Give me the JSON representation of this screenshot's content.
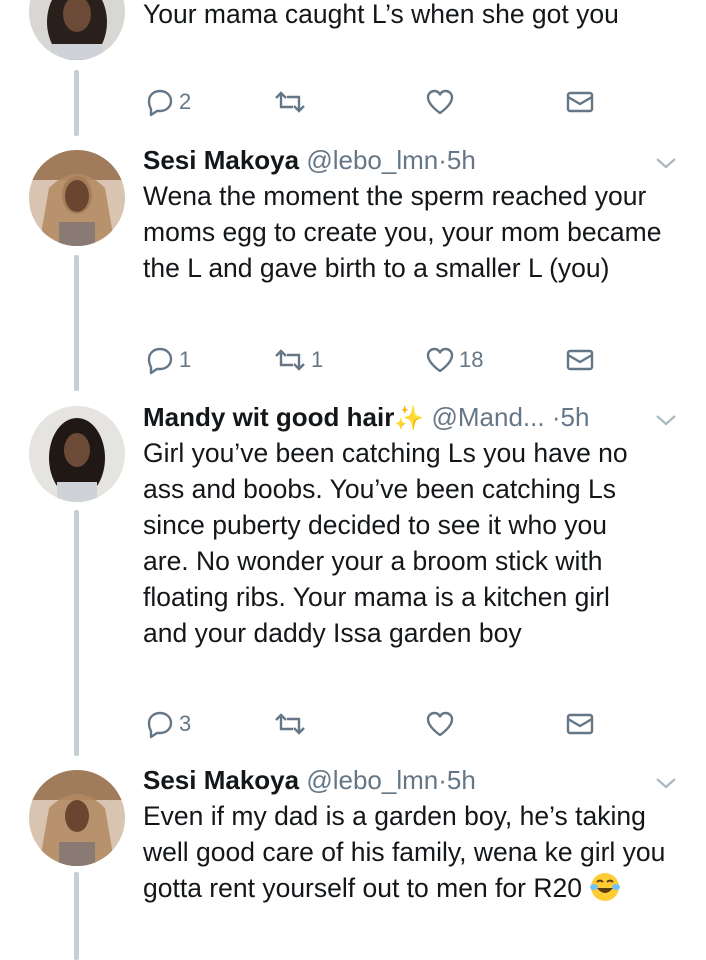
{
  "tweets": [
    {
      "name": "",
      "handle": "",
      "dot": "",
      "time": "",
      "text": "Your mama caught L’s when she got you",
      "actions": {
        "replies": "2",
        "retweets": "",
        "likes": ""
      }
    },
    {
      "name": "Sesi Makoya",
      "handle": "@lebo_lmn",
      "dot": "·",
      "time": "5h",
      "text": "Wena the moment the sperm reached your moms egg to create you, your mom became the L and gave birth to a smaller L (you)",
      "actions": {
        "replies": "1",
        "retweets": "1",
        "likes": "18"
      }
    },
    {
      "name": "Mandy wit good hair",
      "sparkle": "✨",
      "handle": "@Mand...",
      "dot": "·",
      "time": "5h",
      "text": "Girl you’ve been catching Ls you have no ass and boobs. You’ve been catching Ls since puberty decided to see it who you are. No wonder your a broom stick with floating ribs. Your mama is a kitchen girl and your daddy Issa garden boy",
      "actions": {
        "replies": "3",
        "retweets": "",
        "likes": ""
      }
    },
    {
      "name": "Sesi Makoya",
      "handle": "@lebo_lmn",
      "dot": "·",
      "time": "5h",
      "text": "Even if my dad is a garden boy, he’s taking well good care of his family, wena ke girl you gotta rent yourself out to men for R20",
      "emoji": "face-with-tears-of-joy"
    }
  ],
  "icons": {
    "reply": "reply-icon",
    "retweet": "retweet-icon",
    "like": "heart-icon",
    "dm": "envelope-icon",
    "more": "chevron-down-icon"
  },
  "colors": {
    "text": "#14171a",
    "muted": "#657786",
    "thread_line": "#c4cfd6",
    "icon": "#657786"
  }
}
